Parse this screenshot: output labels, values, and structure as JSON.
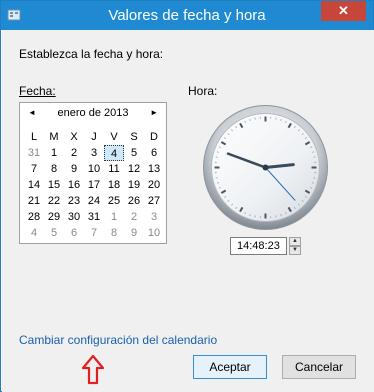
{
  "window": {
    "title": "Valores de fecha y hora",
    "close_label": "✕",
    "accent": "#1f8ad2",
    "close_color": "#c7463a"
  },
  "instructions": "Establezca la fecha y hora:",
  "date_label": "Fecha:",
  "time_label": "Hora:",
  "calendar": {
    "month": "enero de 2013",
    "prev_icon": "◄",
    "next_icon": "►",
    "weekdays": [
      "L",
      "M",
      "X",
      "J",
      "V",
      "S",
      "D"
    ],
    "weeks": [
      [
        {
          "d": "31",
          "o": true
        },
        {
          "d": "1"
        },
        {
          "d": "2"
        },
        {
          "d": "3"
        },
        {
          "d": "4",
          "today": true
        },
        {
          "d": "5"
        },
        {
          "d": "6"
        }
      ],
      [
        {
          "d": "7"
        },
        {
          "d": "8"
        },
        {
          "d": "9"
        },
        {
          "d": "10"
        },
        {
          "d": "11"
        },
        {
          "d": "12"
        },
        {
          "d": "13"
        }
      ],
      [
        {
          "d": "14"
        },
        {
          "d": "15"
        },
        {
          "d": "16"
        },
        {
          "d": "17"
        },
        {
          "d": "18"
        },
        {
          "d": "19"
        },
        {
          "d": "20"
        }
      ],
      [
        {
          "d": "21"
        },
        {
          "d": "22"
        },
        {
          "d": "23"
        },
        {
          "d": "24"
        },
        {
          "d": "25"
        },
        {
          "d": "26"
        },
        {
          "d": "27"
        }
      ],
      [
        {
          "d": "28"
        },
        {
          "d": "29"
        },
        {
          "d": "30"
        },
        {
          "d": "31"
        },
        {
          "d": "1",
          "o": true
        },
        {
          "d": "2",
          "o": true
        },
        {
          "d": "3",
          "o": true
        }
      ],
      [
        {
          "d": "4",
          "o": true
        },
        {
          "d": "5",
          "o": true
        },
        {
          "d": "6",
          "o": true
        },
        {
          "d": "7",
          "o": true
        },
        {
          "d": "8",
          "o": true
        },
        {
          "d": "9",
          "o": true
        },
        {
          "d": "10",
          "o": true
        }
      ]
    ]
  },
  "time": {
    "value": "14:48:23",
    "spin_up": "▲",
    "spin_down": "▼"
  },
  "calendar_settings_link": "Cambiar configuración del calendario",
  "buttons": {
    "ok": "Aceptar",
    "cancel": "Cancelar"
  }
}
